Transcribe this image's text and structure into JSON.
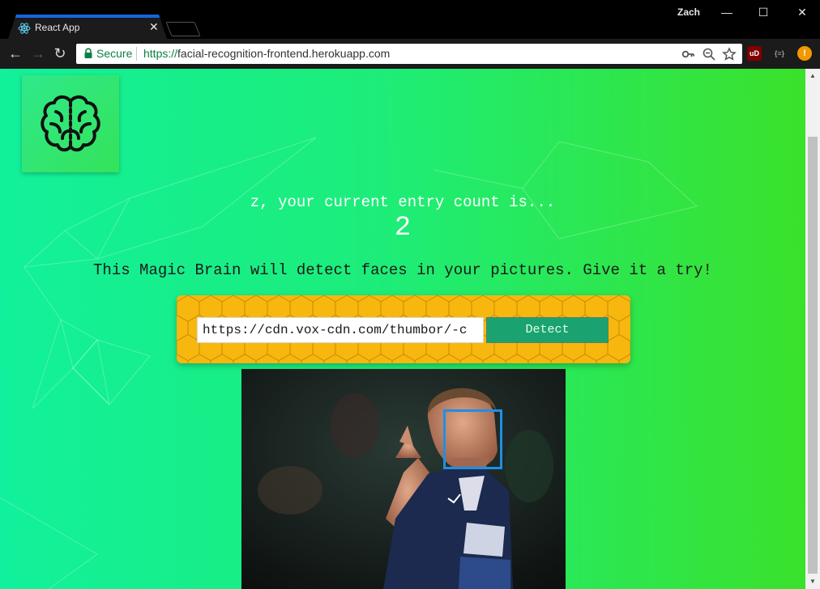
{
  "browser": {
    "tab_title": "React App",
    "tab_icon": "react-icon",
    "profile_name": "Zach",
    "secure_label": "Secure",
    "url_scheme": "https://",
    "url_host": "facial-recognition-frontend.herokuapp.com",
    "icons": {
      "back": "back-arrow-icon",
      "forward": "forward-arrow-icon",
      "reload": "reload-icon",
      "key": "key-icon",
      "zoom": "zoom-out-icon",
      "bookmark": "star-icon",
      "ublock": "ublock-icon",
      "extension": "json-extension-icon",
      "menu": "chrome-menu-alert-icon"
    },
    "extension_labels": {
      "ublock": "uD",
      "json": "{≡}",
      "menu": "!"
    }
  },
  "page": {
    "rank_text": "z, your current entry count is...",
    "rank_count": "2",
    "headline": "This Magic Brain will detect faces in your pictures. Give it a try!",
    "image_input_value": "https://cdn.vox-cdn.com/thumbor/-c",
    "detect_label": "Detect",
    "logo_icon": "brain-icon",
    "detected_faces": 1
  },
  "colors": {
    "gradient_start": "#11f09c",
    "gradient_end": "#3be12a",
    "form_panel": "#f7b70f",
    "detect_button": "#1aa371",
    "face_box": "#1e8fe8",
    "tab_accent": "#1565e0"
  }
}
